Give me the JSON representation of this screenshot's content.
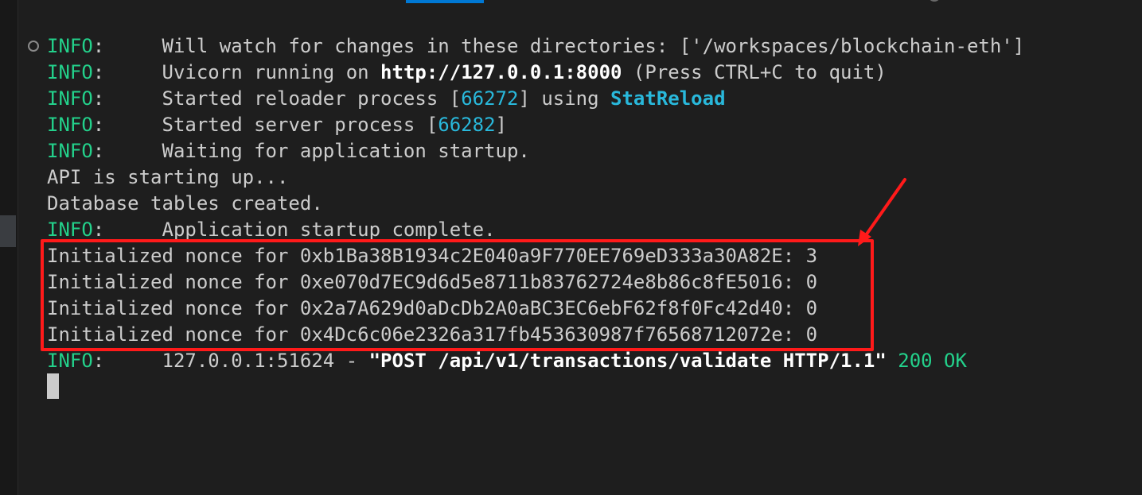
{
  "colors": {
    "background": "#1e1e1e",
    "text": "#cccccc",
    "info_level": "#23d18b",
    "number": "#29b8db",
    "highlight": "#ff1a1a"
  },
  "terminal": {
    "lines": [
      {
        "level": "INFO",
        "sep": ":     ",
        "text": "Will watch for changes in these directories: ['/workspaces/blockchain-eth']"
      },
      {
        "level": "INFO",
        "sep": ":     ",
        "pre": "Uvicorn running on ",
        "url": "http://127.0.0.1:8000",
        "post": " (Press CTRL+C to quit)"
      },
      {
        "level": "INFO",
        "sep": ":     ",
        "pre": "Started reloader process [",
        "pid": "66272",
        "mid": "] using ",
        "reloader": "StatReload"
      },
      {
        "level": "INFO",
        "sep": ":     ",
        "pre": "Started server process [",
        "pid": "66282",
        "post": "]"
      },
      {
        "level": "INFO",
        "sep": ":     ",
        "text": "Waiting for application startup."
      },
      {
        "text": "API is starting up..."
      },
      {
        "text": "Database tables created."
      },
      {
        "level": "INFO",
        "sep": ":     ",
        "text": "Application startup complete."
      },
      {
        "text": "Initialized nonce for 0xb1Ba38B1934c2E040a9F770EE769eD333a30A82E: 3"
      },
      {
        "text": "Initialized nonce for 0xe070d7EC9d6d5e8711b83762724e8b86c8fE5016: 0"
      },
      {
        "text": "Initialized nonce for 0x2a7A629d0aDcDb2A0aBC3EC6ebF62f8f0Fc42d40: 0"
      },
      {
        "text": "Initialized nonce for 0x4Dc6c06e2326a317fb453630987f76568712072e: 0"
      },
      {
        "level": "INFO",
        "sep": ":     ",
        "pre": "127.0.0.1:51624 - ",
        "request": "\"POST /api/v1/transactions/validate HTTP/1.1\"",
        "status": " 200 OK"
      }
    ]
  }
}
